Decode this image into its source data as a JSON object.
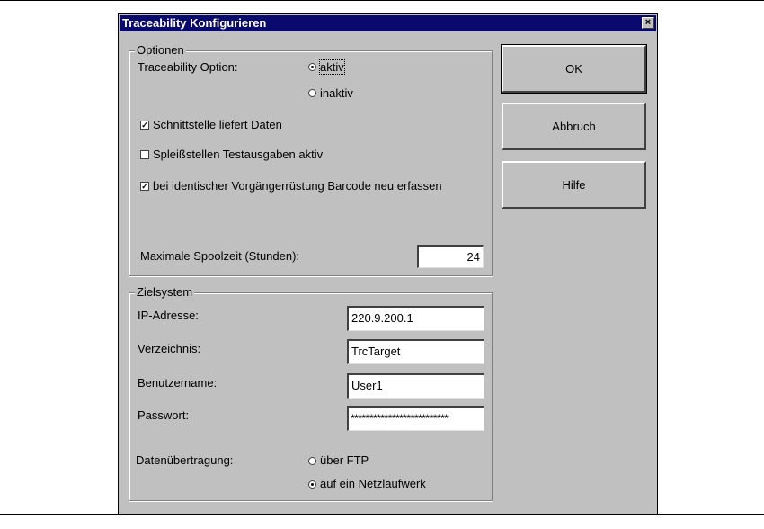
{
  "dialog": {
    "title": "Traceability Konfigurieren",
    "close_glyph": "×"
  },
  "optionen": {
    "legend": "Optionen",
    "traceability_label": "Traceability Option:",
    "radio_aktiv": "aktiv",
    "radio_inaktiv": "inaktiv",
    "traceability_selected": "aktiv",
    "chk_schnittstelle": "Schnittstelle liefert Daten",
    "chk_schnittstelle_checked": true,
    "chk_spleiss": "Spleißstellen Testausgaben aktiv",
    "chk_spleiss_checked": false,
    "chk_barcode": "bei identischer Vorgängerrüstung Barcode neu erfassen",
    "chk_barcode_checked": true,
    "spoolzeit_label": "Maximale Spoolzeit (Stunden):",
    "spoolzeit_value": "24"
  },
  "zielsystem": {
    "legend": "Zielsystem",
    "ip_label": "IP-Adresse:",
    "ip_value": "220.9.200.1",
    "dir_label": "Verzeichnis:",
    "dir_value": "TrcTarget",
    "user_label": "Benutzername:",
    "user_value": "User1",
    "pw_label": "Passwort:",
    "pw_value": "**************************",
    "transfer_label": "Datenübertragung:",
    "radio_ftp": "über FTP",
    "radio_netz": "auf ein Netzlaufwerk",
    "transfer_selected": "auf ein Netzlaufwerk"
  },
  "buttons": {
    "ok": "OK",
    "cancel": "Abbruch",
    "help": "Hilfe"
  },
  "glyphs": {
    "check": "✓"
  }
}
